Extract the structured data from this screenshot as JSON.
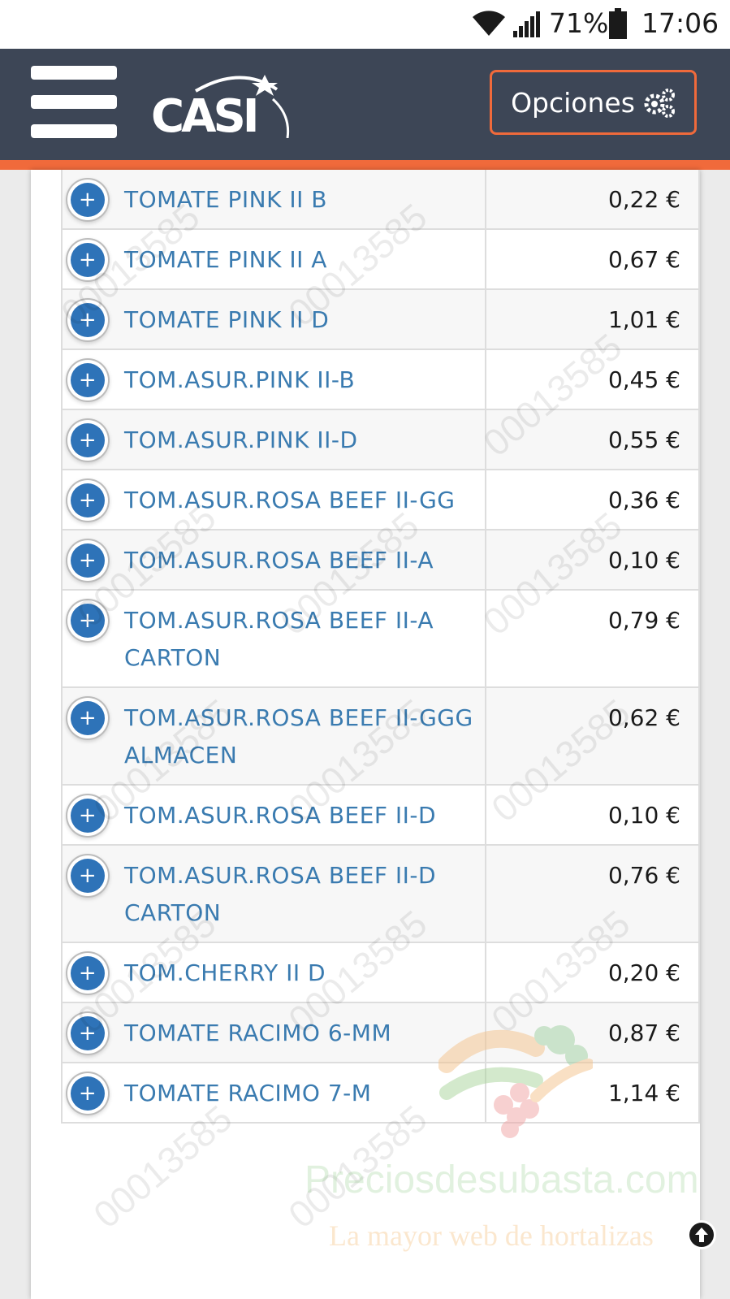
{
  "status_bar": {
    "battery_pct": "71%",
    "time": "17:06",
    "icons": [
      "wifi-icon",
      "signal-icon",
      "battery-icon"
    ]
  },
  "header": {
    "logo_text": "CASI",
    "options_label": "Opciones",
    "options_icon": "gears-icon",
    "colors": {
      "background": "#3d4656",
      "accent": "#f06a3b"
    }
  },
  "products": [
    {
      "name": "TOMATE PINK II B",
      "price": "0,22 €"
    },
    {
      "name": "TOMATE PINK II A",
      "price": "0,67 €"
    },
    {
      "name": "TOMATE PINK II D",
      "price": "1,01 €"
    },
    {
      "name": "TOM.ASUR.PINK II-B",
      "price": "0,45 €"
    },
    {
      "name": "TOM.ASUR.PINK II-D",
      "price": "0,55 €"
    },
    {
      "name": "TOM.ASUR.ROSA BEEF II-GG",
      "price": "0,36 €"
    },
    {
      "name": "TOM.ASUR.ROSA BEEF II-A",
      "price": "0,10 €"
    },
    {
      "name": "TOM.ASUR.ROSA BEEF II-A CARTON",
      "price": "0,79 €"
    },
    {
      "name": "TOM.ASUR.ROSA BEEF II-GGG ALMACEN",
      "price": "0,62 €"
    },
    {
      "name": "TOM.ASUR.ROSA BEEF II-D",
      "price": "0,10 €"
    },
    {
      "name": "TOM.ASUR.ROSA BEEF II-D CARTON",
      "price": "0,76 €"
    },
    {
      "name": "TOM.CHERRY II D",
      "price": "0,20 €"
    },
    {
      "name": "TOMATE RACIMO 6-MM",
      "price": "0,87 €"
    },
    {
      "name": "TOMATE RACIMO 7-M",
      "price": "1,14 €"
    }
  ],
  "watermark": {
    "code": "00013585",
    "brand_name": "Preciosdesubasta.com",
    "brand_tagline": "La mayor web de hortalizas"
  },
  "row_icon": "plus-circle-icon",
  "scroll_top_icon": "arrow-up-circle-icon",
  "colors": {
    "link": "#3a7bb0",
    "plus": "#2e73b8"
  }
}
